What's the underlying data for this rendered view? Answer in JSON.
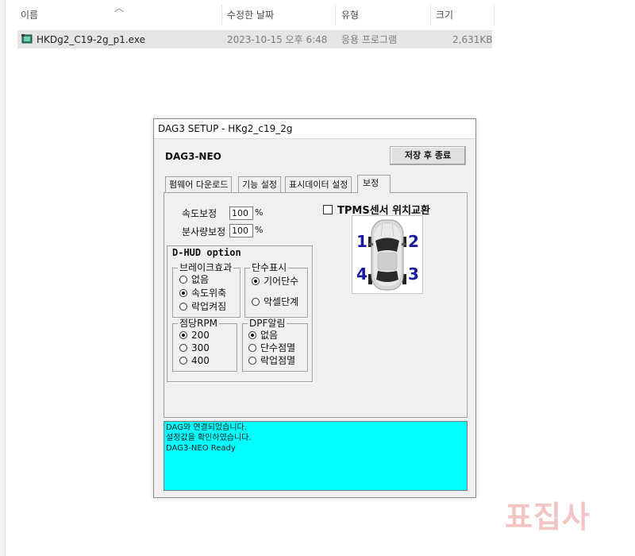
{
  "explorer": {
    "columns": {
      "name": "이름",
      "modified": "수정한 날짜",
      "type": "유형",
      "size": "크기"
    },
    "file": {
      "name": "HKDg2_C19-2g_p1.exe",
      "modified": "2023-10-15 오후 6:48",
      "type": "응용 프로그램",
      "size": "2,631KB"
    }
  },
  "dialog": {
    "title": "DAG3 SETUP - HKg2_c19_2g",
    "app_label": "DAG3-NEO",
    "save_exit_label": "저장 후 종료",
    "tabs": [
      {
        "label": "펌웨어 다운로드",
        "active": false
      },
      {
        "label": "기능 설정",
        "active": false
      },
      {
        "label": "표시데이터 설정",
        "active": false
      },
      {
        "label": "보정",
        "active": true
      }
    ],
    "speed_correction": {
      "label": "속도보정",
      "value": "100",
      "unit": "%"
    },
    "injection_correction": {
      "label": "분사량보정",
      "value": "100",
      "unit": "%"
    },
    "tpms": {
      "label": "TPMS센서 위치교환",
      "checked": false
    },
    "wheel_numbers": [
      "1",
      "2",
      "3",
      "4"
    ],
    "dhud": {
      "title": "D-HUD option",
      "brake_effect": {
        "title": "브레이크효과",
        "options": [
          {
            "label": "없음",
            "checked": false
          },
          {
            "label": "속도위축",
            "checked": true
          },
          {
            "label": "락업켜짐",
            "checked": false
          }
        ]
      },
      "gear_display": {
        "title": "단수표시",
        "options": [
          {
            "label": "기어단수",
            "checked": true
          },
          {
            "label": "악셀단계",
            "checked": false
          }
        ]
      },
      "dot_rpm": {
        "title": "점당RPM",
        "options": [
          {
            "label": "200",
            "checked": true
          },
          {
            "label": "300",
            "checked": false
          },
          {
            "label": "400",
            "checked": false
          }
        ]
      },
      "dpf_alarm": {
        "title": "DPF알림",
        "options": [
          {
            "label": "없음",
            "checked": true
          },
          {
            "label": "단수점멸",
            "checked": false
          },
          {
            "label": "락업점멸",
            "checked": false
          }
        ]
      }
    },
    "status_lines": [
      "DAG와 연결되었습니다.",
      "설정값을 확인하였습니다.",
      "DAG3-NEO Ready"
    ],
    "status_color": "#00ffff"
  },
  "watermark": "표집사",
  "colors": {
    "wheel_number": "#1a1aa0",
    "watermark": "#f2c4c4"
  }
}
